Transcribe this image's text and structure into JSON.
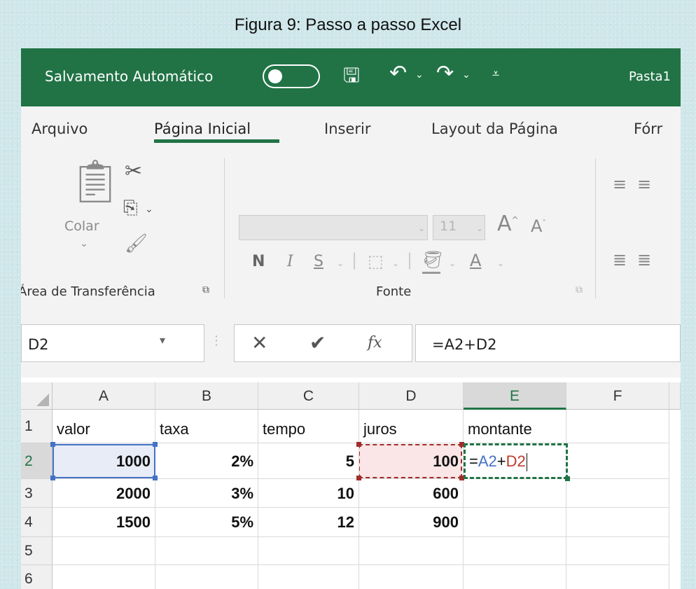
{
  "caption": "Figura 9: Passo a passo Excel",
  "titlebar": {
    "autosave_label": "Salvamento Automático",
    "workbook_name": "Pasta1"
  },
  "menu": {
    "tabs": [
      "Arquivo",
      "Página Inicial",
      "Inserir",
      "Layout da Página",
      "Fórr"
    ],
    "active_tab": "Página Inicial"
  },
  "ribbon": {
    "clipboard": {
      "paste_label": "Colar",
      "group_label": "Área de Transferência"
    },
    "font": {
      "size": "11",
      "bold": "N",
      "italic": "I",
      "underline": "S",
      "grow": "A",
      "shrink": "A",
      "font_color": "A",
      "group_label": "Fonte"
    }
  },
  "formula_bar": {
    "name_box": "D2",
    "fx": "fx",
    "formula": "=A2+D2"
  },
  "sheet": {
    "columns": [
      "A",
      "B",
      "C",
      "D",
      "E",
      "F"
    ],
    "selected_column": "E",
    "rows": [
      {
        "num": "1",
        "cells": [
          "valor",
          "taxa",
          "tempo",
          "juros",
          "montante",
          ""
        ]
      },
      {
        "num": "2",
        "cells": [
          "1000",
          "2%",
          "5",
          "100",
          "",
          ""
        ]
      },
      {
        "num": "3",
        "cells": [
          "2000",
          "3%",
          "10",
          "600",
          "",
          ""
        ]
      },
      {
        "num": "4",
        "cells": [
          "1500",
          "5%",
          "12",
          "900",
          "",
          ""
        ]
      },
      {
        "num": "5",
        "cells": [
          "",
          "",
          "",
          "",
          "",
          ""
        ]
      },
      {
        "num": "6",
        "cells": [
          "",
          "",
          "",
          "",
          "",
          ""
        ]
      }
    ],
    "editing_cell": {
      "ref": "E2",
      "prefix": "=",
      "ref1": "A2",
      "op": "+",
      "ref2": "D2"
    }
  },
  "colors": {
    "excel_green": "#217346",
    "ref_blue": "#4472c4",
    "ref_red": "#c0392b"
  }
}
